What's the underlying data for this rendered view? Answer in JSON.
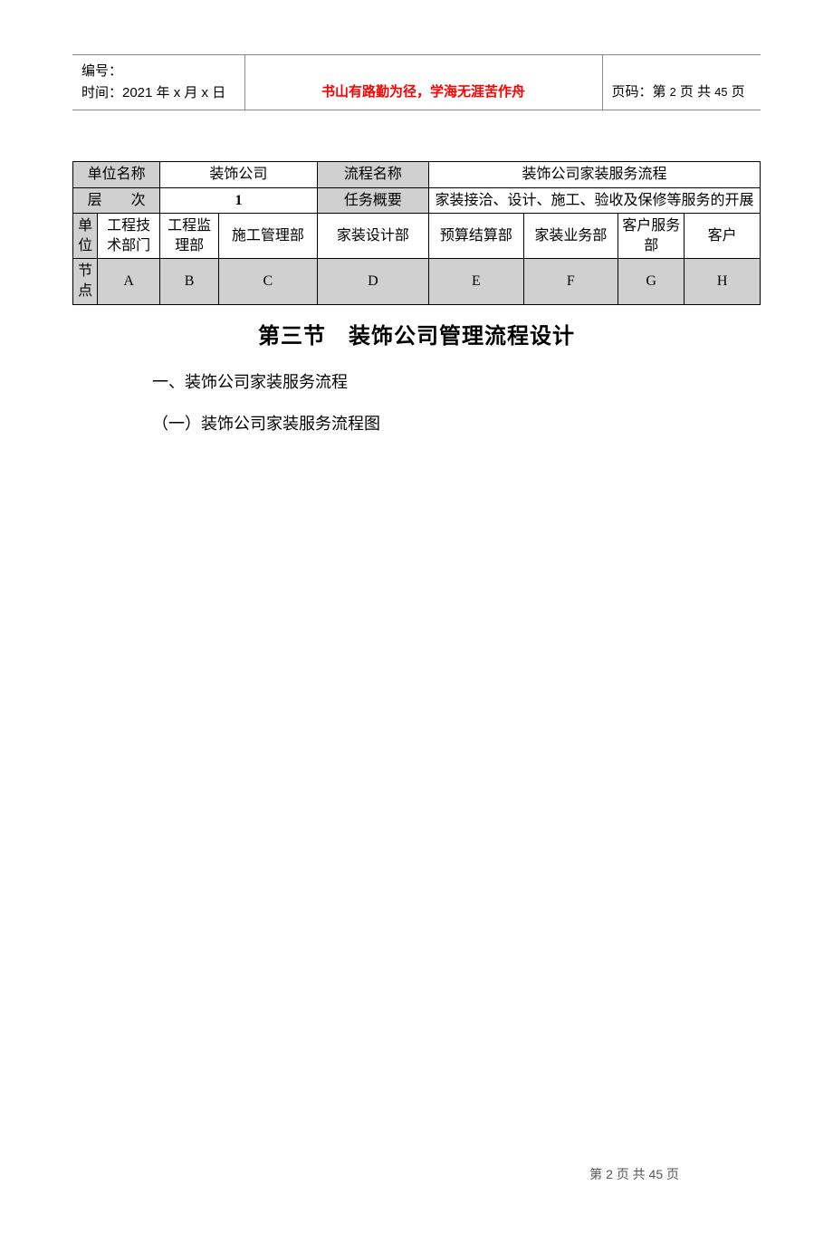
{
  "header": {
    "id_label": "编号：",
    "date_line": "时间：2021 年 x 月 x 日",
    "motto": "书山有路勤为径，学海无涯苦作舟",
    "page_label_prefix": "页码：第 ",
    "page_current": "2",
    "page_mid": " 页  共 ",
    "page_total": "45",
    "page_suffix": " 页"
  },
  "table": {
    "row1": {
      "unit_name_label": "单位名称",
      "unit_name_value": "装饰公司",
      "flow_name_label": "流程名称",
      "flow_name_value": "装饰公司家装服务流程"
    },
    "row2": {
      "level_label": "层　　次",
      "level_value": "1",
      "task_label": "任务概要",
      "task_value": "家装接洽、设计、施工、验收及保修等服务的开展"
    },
    "row3": {
      "unit_label": "单位",
      "d1": "工程技术部门",
      "d2": "工程监理部",
      "d3": "施工管理部",
      "d4": "家装设计部",
      "d5": "预算结算部",
      "d6": "家装业务部",
      "d7": "客户服务部",
      "d8": "客户"
    },
    "row4": {
      "node_label": "节点",
      "a": "A",
      "b": "B",
      "c": "C",
      "d": "D",
      "e": "E",
      "f": "F",
      "g": "G",
      "h": "H"
    }
  },
  "body": {
    "section_title": "第三节　装饰公司管理流程设计",
    "heading1": "一、装饰公司家装服务流程",
    "heading2": "（一）装饰公司家装服务流程图"
  },
  "footer": {
    "prefix": "第 ",
    "current": "2",
    "mid": " 页 共 ",
    "total": "45",
    "suffix": " 页"
  }
}
